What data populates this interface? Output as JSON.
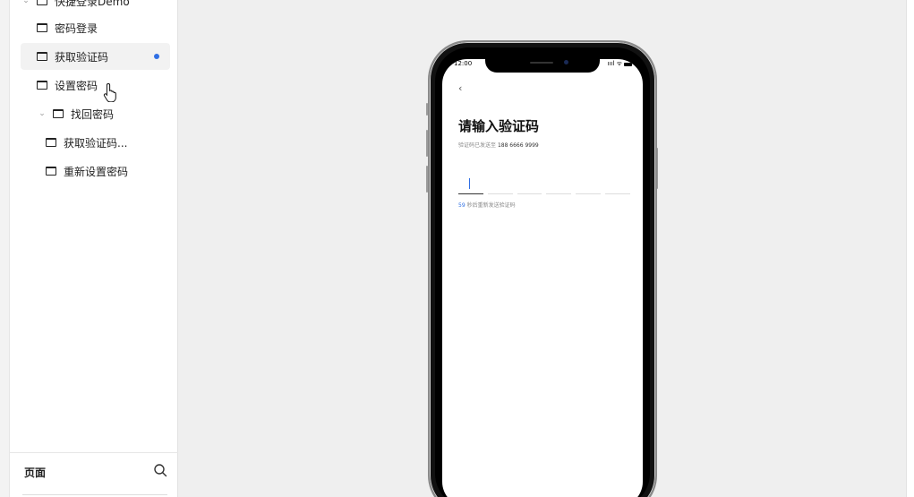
{
  "sidebar": {
    "tree": [
      {
        "label": "快捷登录Demo",
        "level": 0,
        "chevron": "⌄",
        "active": false
      },
      {
        "label": "密码登录",
        "level": 1,
        "chevron": "",
        "active": false
      },
      {
        "label": "获取验证码",
        "level": 1,
        "chevron": "",
        "active": true,
        "indicator": true
      },
      {
        "label": "设置密码",
        "level": 1,
        "chevron": "",
        "active": false
      },
      {
        "label": "找回密码",
        "level": 0,
        "chevron": "⌄",
        "active": false
      },
      {
        "label": "获取验证码...",
        "level": 1,
        "chevron": "",
        "active": false
      },
      {
        "label": "重新设置密码",
        "level": 1,
        "chevron": "",
        "active": false
      }
    ],
    "footer_title": "页面",
    "search_icon": "search-icon"
  },
  "phone": {
    "status_time": "12:00",
    "status_icons": "ıııl ᯤ",
    "back_glyph": "‹",
    "headline": "请输入验证码",
    "sent_prefix": "验证码已发送至",
    "phone_number": "188 6666 9999",
    "code_boxes": 6,
    "countdown": "59",
    "resend_text": "秒后重新发送验证码"
  },
  "colors": {
    "accent": "#2f6fe4",
    "canvas": "#efefef"
  }
}
